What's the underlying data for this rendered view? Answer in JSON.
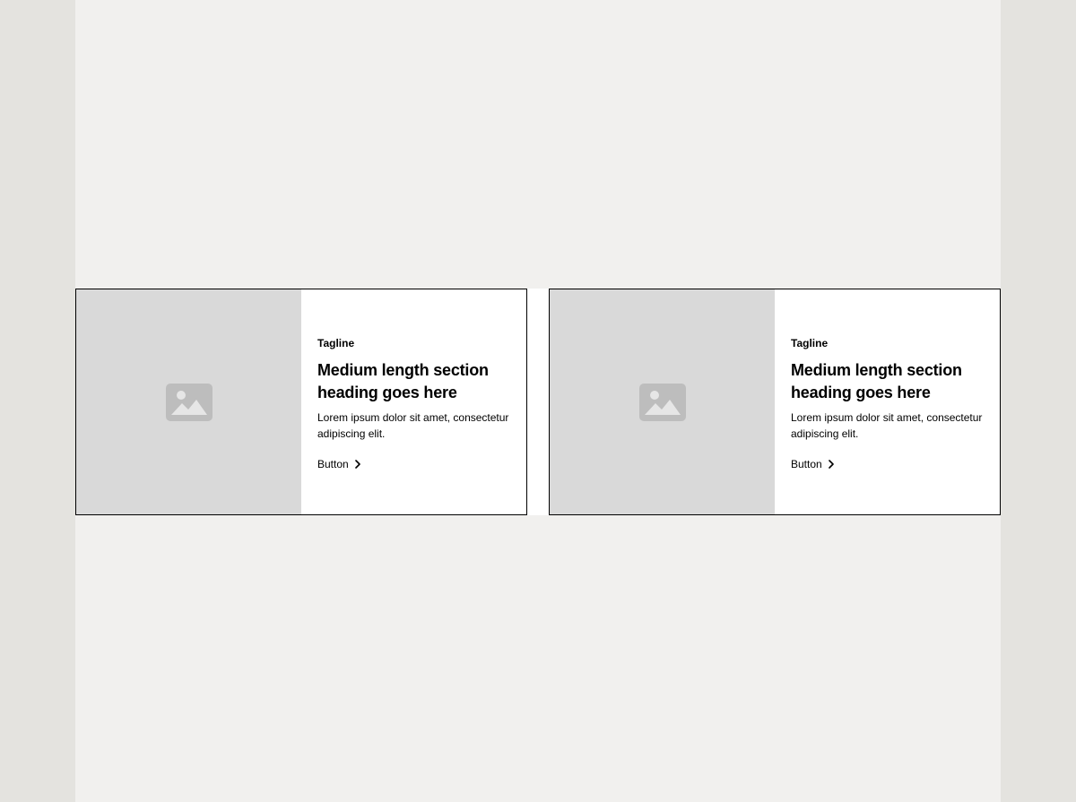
{
  "cards": [
    {
      "image_icon": "image-placeholder-icon",
      "tagline": "Tagline",
      "heading": "Medium length section heading goes here",
      "body": "Lorem ipsum dolor sit amet, consectetur adipiscing elit.",
      "button_label": "Button",
      "button_icon": "chevron-right-icon"
    },
    {
      "image_icon": "image-placeholder-icon",
      "tagline": "Tagline",
      "heading": "Medium length section heading goes here",
      "body": "Lorem ipsum dolor sit amet, consectetur adipiscing elit.",
      "button_label": "Button",
      "button_icon": "chevron-right-icon"
    }
  ],
  "colors": {
    "outer_background": "#e4e3df",
    "page_background": "#f1f0ee",
    "card_background": "#ffffff",
    "image_placeholder": "#d9d9d9",
    "placeholder_icon": "#bdbdbd",
    "text": "#000000"
  }
}
